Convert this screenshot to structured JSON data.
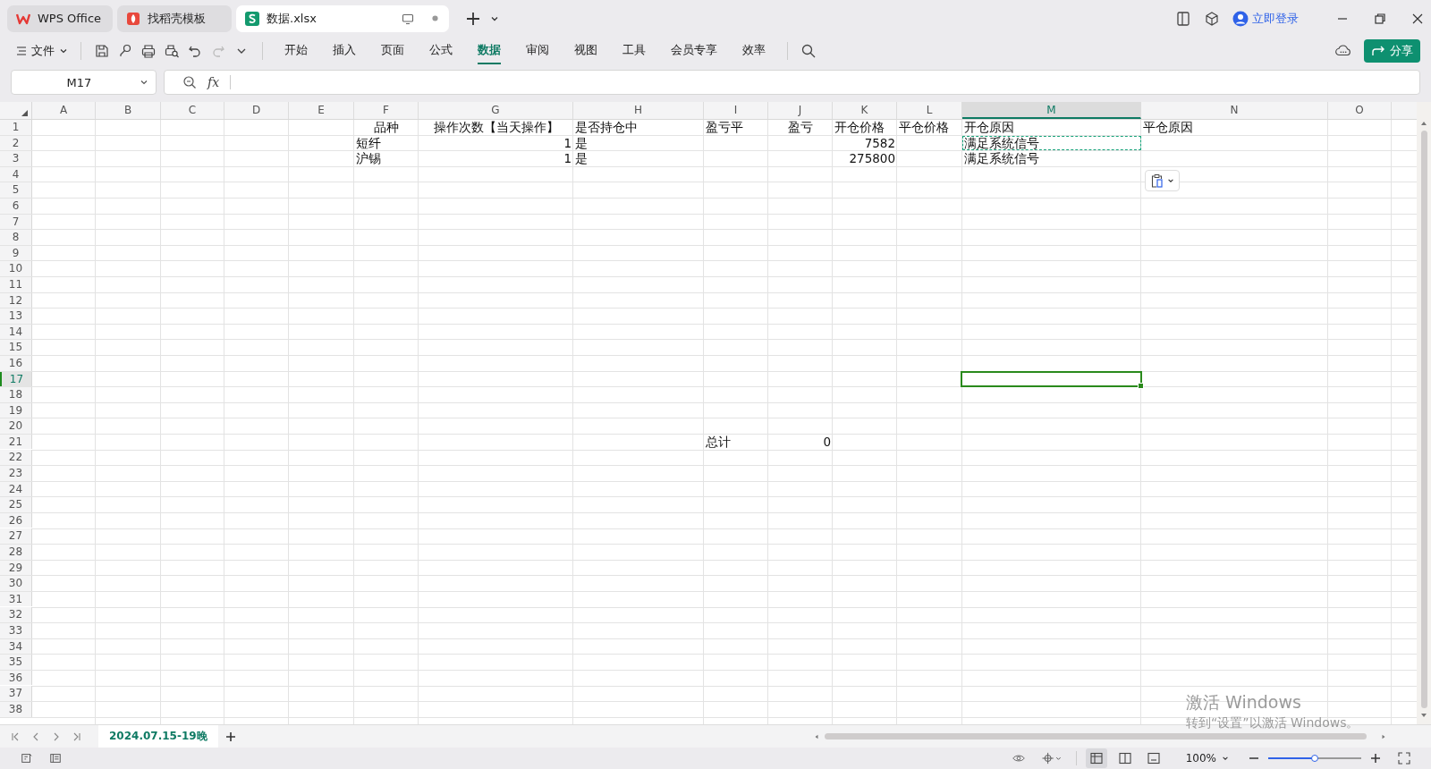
{
  "app_tabs": [
    {
      "label": "WPS Office",
      "kind": "wps",
      "selected": false
    },
    {
      "label": "找稻壳模板",
      "kind": "docer",
      "selected": false
    },
    {
      "label": "数据.xlsx",
      "kind": "sheet",
      "selected": true
    }
  ],
  "account": {
    "label": "立即登录"
  },
  "menu": {
    "file": "文件",
    "tabs": [
      {
        "label": "开始",
        "selected": false
      },
      {
        "label": "插入",
        "selected": false
      },
      {
        "label": "页面",
        "selected": false
      },
      {
        "label": "公式",
        "selected": false
      },
      {
        "label": "数据",
        "selected": true
      },
      {
        "label": "审阅",
        "selected": false
      },
      {
        "label": "视图",
        "selected": false
      },
      {
        "label": "工具",
        "selected": false
      },
      {
        "label": "会员专享",
        "selected": false
      },
      {
        "label": "效率",
        "selected": false
      }
    ],
    "share": "分享"
  },
  "formula_bar": {
    "name_box": "M17",
    "fx": "fx"
  },
  "grid": {
    "columns": [
      {
        "label": "A",
        "selected": false
      },
      {
        "label": "B",
        "selected": false
      },
      {
        "label": "C",
        "selected": false
      },
      {
        "label": "D",
        "selected": false
      },
      {
        "label": "E",
        "selected": false
      },
      {
        "label": "F",
        "selected": false
      },
      {
        "label": "G",
        "selected": false
      },
      {
        "label": "H",
        "selected": false
      },
      {
        "label": "I",
        "selected": false
      },
      {
        "label": "J",
        "selected": false
      },
      {
        "label": "K",
        "selected": false
      },
      {
        "label": "L",
        "selected": false
      },
      {
        "label": "M",
        "selected": true
      },
      {
        "label": "N",
        "selected": false
      },
      {
        "label": "O",
        "selected": false
      }
    ],
    "rows": [
      {
        "label": "1",
        "selected": false,
        "cells": [
          null,
          null,
          null,
          null,
          null,
          {
            "text": "品种",
            "kind": "centered"
          },
          {
            "text": "操作次数【当天操作】",
            "kind": "centered"
          },
          {
            "text": "是否持仓中",
            "kind": "text"
          },
          {
            "text": "盈亏平",
            "kind": "text"
          },
          {
            "text": "盈亏",
            "kind": "centered"
          },
          {
            "text": "开仓价格",
            "kind": "text"
          },
          {
            "text": "平仓价格",
            "kind": "text"
          },
          {
            "text": "开仓原因",
            "kind": "text"
          },
          {
            "text": "平仓原因",
            "kind": "text"
          },
          null
        ]
      },
      {
        "label": "2",
        "selected": false,
        "cells": [
          null,
          null,
          null,
          null,
          null,
          {
            "text": "短纤",
            "kind": "text"
          },
          {
            "text": "1",
            "kind": "number"
          },
          {
            "text": "是",
            "kind": "text"
          },
          null,
          null,
          {
            "text": "7582",
            "kind": "number"
          },
          null,
          {
            "text": "满足系统信号",
            "kind": "text",
            "copied": true
          },
          null,
          null
        ]
      },
      {
        "label": "3",
        "selected": false,
        "cells": [
          null,
          null,
          null,
          null,
          null,
          {
            "text": "沪锡",
            "kind": "text"
          },
          {
            "text": "1",
            "kind": "number"
          },
          {
            "text": "是",
            "kind": "text"
          },
          null,
          null,
          {
            "text": "275800",
            "kind": "number"
          },
          null,
          {
            "text": "满足系统信号",
            "kind": "text",
            "copied": false
          },
          null,
          null
        ]
      },
      {
        "label": "4",
        "selected": false
      },
      {
        "label": "5",
        "selected": false
      },
      {
        "label": "6",
        "selected": false
      },
      {
        "label": "7",
        "selected": false
      },
      {
        "label": "8",
        "selected": false
      },
      {
        "label": "9",
        "selected": false
      },
      {
        "label": "10",
        "selected": false
      },
      {
        "label": "11",
        "selected": false
      },
      {
        "label": "12",
        "selected": false
      },
      {
        "label": "13",
        "selected": false
      },
      {
        "label": "14",
        "selected": false
      },
      {
        "label": "15",
        "selected": false
      },
      {
        "label": "16",
        "selected": false
      },
      {
        "label": "17",
        "selected": true
      },
      {
        "label": "18",
        "selected": false
      },
      {
        "label": "19",
        "selected": false
      },
      {
        "label": "20",
        "selected": false
      },
      {
        "label": "21",
        "selected": false,
        "cells": [
          null,
          null,
          null,
          null,
          null,
          null,
          null,
          null,
          {
            "text": "总计",
            "kind": "text"
          },
          {
            "text": "0",
            "kind": "number"
          },
          null,
          null,
          null,
          null,
          null
        ]
      },
      {
        "label": "22",
        "selected": false
      },
      {
        "label": "23",
        "selected": false
      },
      {
        "label": "24",
        "selected": false
      },
      {
        "label": "25",
        "selected": false
      },
      {
        "label": "26",
        "selected": false
      },
      {
        "label": "27",
        "selected": false
      },
      {
        "label": "28",
        "selected": false
      },
      {
        "label": "29",
        "selected": false
      },
      {
        "label": "30",
        "selected": false
      },
      {
        "label": "31",
        "selected": false
      },
      {
        "label": "32",
        "selected": false
      },
      {
        "label": "33",
        "selected": false
      },
      {
        "label": "34",
        "selected": false
      },
      {
        "label": "35",
        "selected": false
      },
      {
        "label": "36",
        "selected": false
      },
      {
        "label": "37",
        "selected": false
      },
      {
        "label": "38",
        "selected": false
      }
    ]
  },
  "sheet_tabs": [
    {
      "label": "2024.07.15-19晚",
      "selected": true
    }
  ],
  "status_bar": {
    "views": [
      {
        "kind": "normal",
        "selected": true
      },
      {
        "kind": "split",
        "selected": false
      },
      {
        "kind": "page",
        "selected": false
      }
    ],
    "zoom": "100%",
    "zoom_slider": {
      "level": 0.5
    }
  },
  "os_overlay": {
    "title": "激活 Windows",
    "subtitle": "转到“设置”以激活 Windows。"
  }
}
